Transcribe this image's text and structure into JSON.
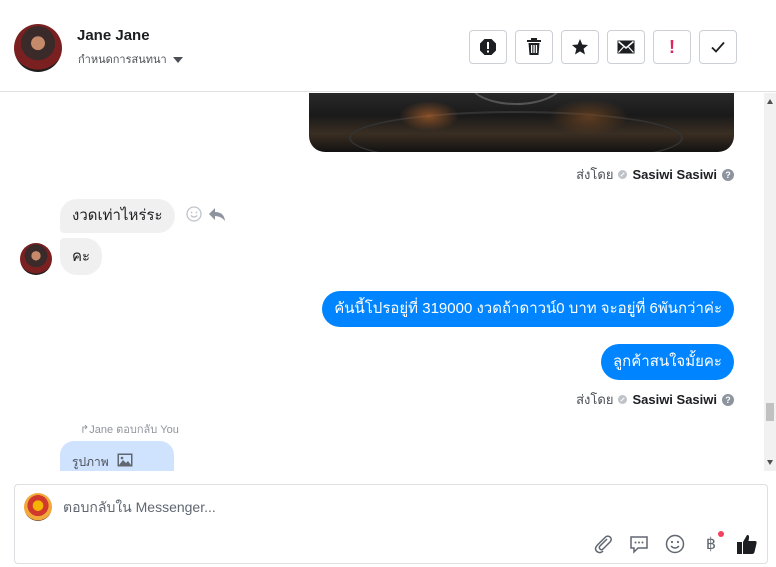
{
  "header": {
    "contact_name": "Jane Jane",
    "conversation_settings": "กำหนดการสนทนา",
    "action_icons": [
      "spam-icon",
      "trash-icon",
      "star-icon",
      "mail-icon",
      "follow-up-icon",
      "done-icon"
    ],
    "follow_up_mark": "!"
  },
  "thread": {
    "sent_by_label": "ส่งโดย",
    "sent_by_name": "Sasiwi Sasiwi",
    "help_mark": "?",
    "incoming": [
      "งวดเท่าไหร่ระ",
      "คะ"
    ],
    "outgoing": [
      "คันนี้โปรอยู่ที่ 319000 งวดถ้าดาวน์0 บาท จะอยู่ที่ 6พันกว่าค่ะ",
      "ลูกค้าสนใจมั้ยคะ"
    ],
    "reply_note": "Jane ตอบกลับ You",
    "reply_card_text": "รูปภาพ"
  },
  "composer": {
    "placeholder": "ตอบกลับใน Messenger...",
    "tools": [
      "attachment-icon",
      "saved-reply-icon",
      "emoji-icon",
      "payment-icon",
      "like-icon"
    ],
    "payment_symbol": "฿"
  },
  "colors": {
    "accent": "#0084ff",
    "incoming_bubble": "#f1f0f0",
    "reply_card": "#cfe3ff",
    "notification_dot": "#f3425f"
  }
}
